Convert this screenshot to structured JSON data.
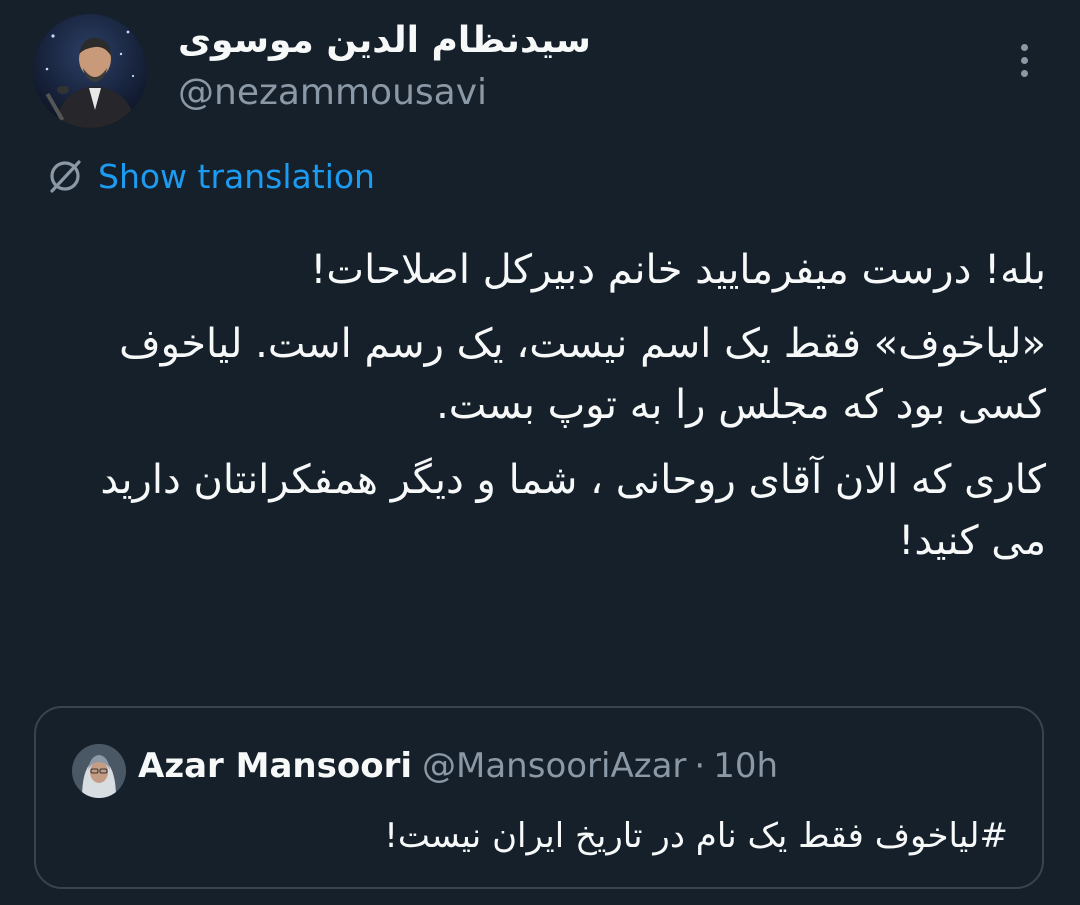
{
  "author": {
    "display_name": "سیدنظام الدین موسوی",
    "handle": "@nezammousavi",
    "avatar_icon": "author-avatar"
  },
  "more_icon": "more-dots-icon",
  "translation": {
    "icon": "globe-translate-icon",
    "label": "Show translation"
  },
  "tweet": {
    "paragraphs": [
      "بله! درست میفرمایید خانم دبیرکل اصلاحات!",
      "«لیاخوف» فقط یک اسم نیست، یک رسم است. لیاخوف کسی بود که مجلس را به توپ بست.",
      "کاری که الان آقای روحانی ، شما و دیگر همفکرانتان دارید می کنید!"
    ]
  },
  "quoted_tweet": {
    "avatar_icon": "quoted-author-avatar",
    "display_name": "Azar Mansoori",
    "handle": "@MansooriAzar",
    "separator": "·",
    "time": "10h",
    "text": "#لیاخوف فقط یک نام در تاریخ ایران نیست!"
  },
  "colors": {
    "background": "#15202b",
    "text_primary": "#f7f9f9",
    "text_secondary": "#8b98a5",
    "accent": "#1d9bf0",
    "border": "#38444d"
  }
}
